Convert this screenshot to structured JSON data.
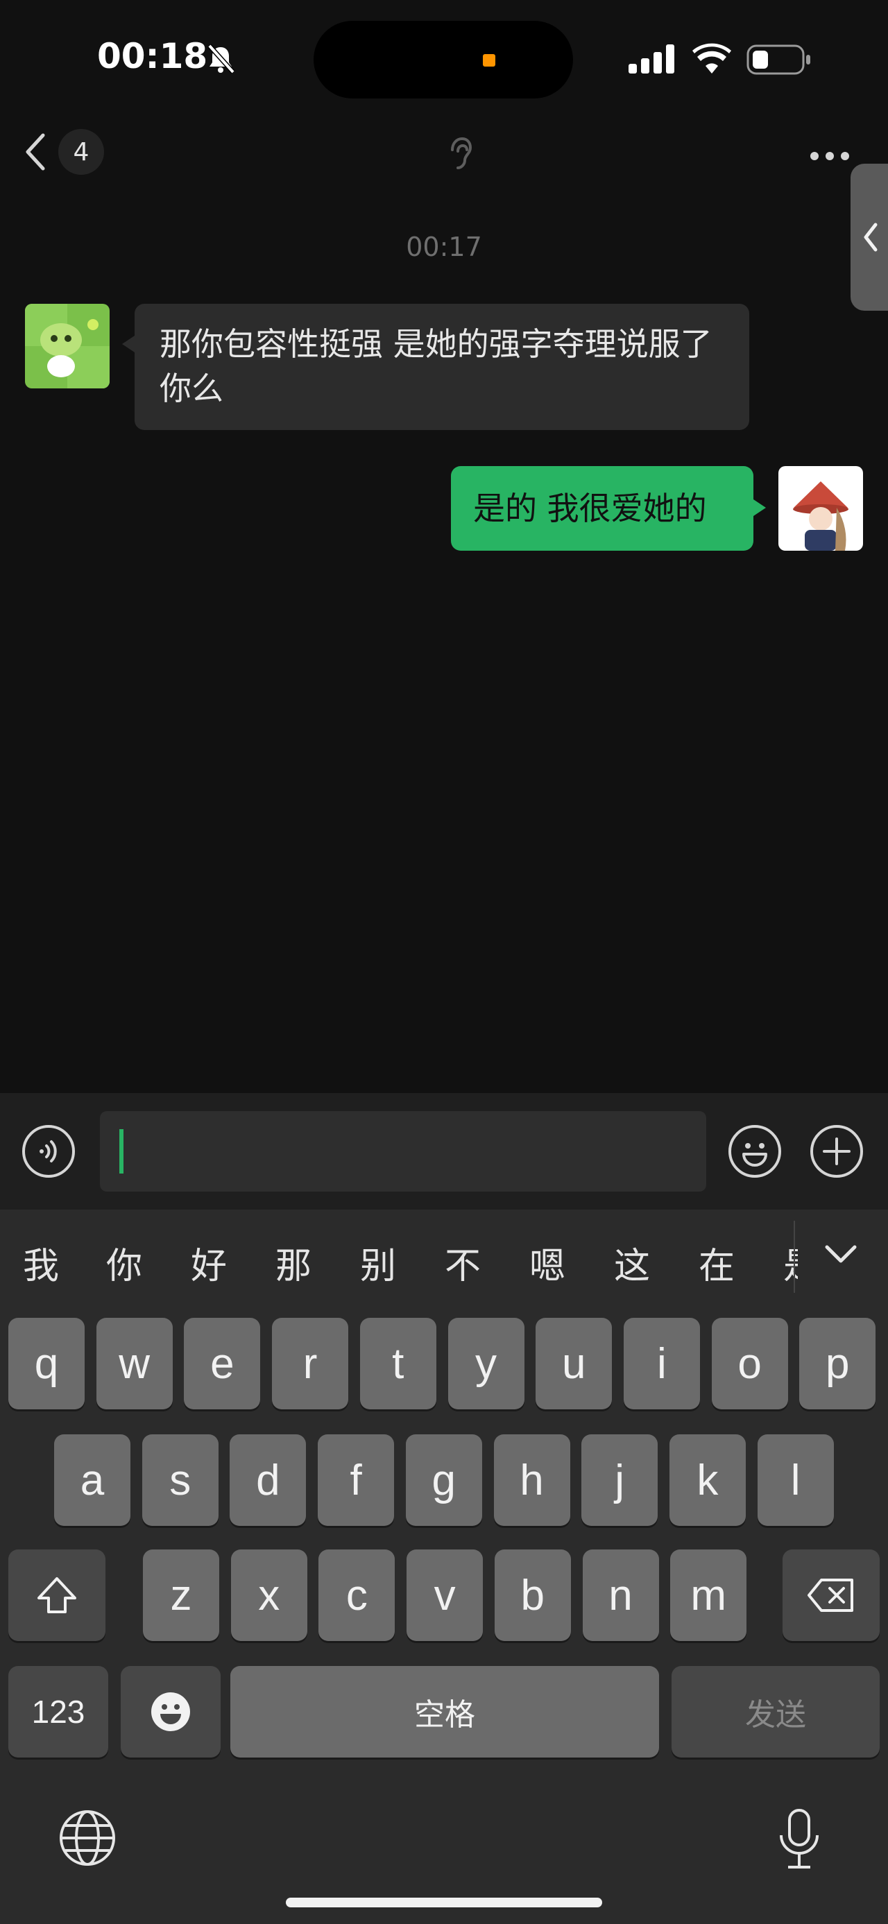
{
  "status_bar": {
    "time": "00:18"
  },
  "nav": {
    "back_count": "4"
  },
  "chat": {
    "timestamp": "00:17",
    "messages": [
      {
        "side": "left",
        "text": "那你包容性挺强 是她的强字夺理说服了你么"
      },
      {
        "side": "right",
        "text": "是的 我很爱她的"
      }
    ]
  },
  "input": {
    "value": "",
    "placeholder": ""
  },
  "keyboard": {
    "candidates": [
      "我",
      "你",
      "好",
      "那",
      "别",
      "不",
      "嗯",
      "这",
      "在",
      "是"
    ],
    "row1": [
      "q",
      "w",
      "e",
      "r",
      "t",
      "y",
      "u",
      "i",
      "o",
      "p"
    ],
    "row2": [
      "a",
      "s",
      "d",
      "f",
      "g",
      "h",
      "j",
      "k",
      "l"
    ],
    "row3": [
      "z",
      "x",
      "c",
      "v",
      "b",
      "n",
      "m"
    ],
    "numbers_label": "123",
    "space_label": "空格",
    "send_label": "发送"
  },
  "icons": [
    "bell-mute-icon",
    "signal-icon",
    "wifi-icon",
    "battery-icon",
    "back-chevron-icon",
    "ear-icon",
    "more-icon",
    "voice-icon",
    "emoji-icon",
    "plus-icon",
    "shift-icon",
    "delete-icon",
    "globe-icon",
    "mic-icon",
    "collapse-icon"
  ],
  "colors": {
    "accent": "#28b463",
    "background": "#111111",
    "bubble_left": "#2c2c2c"
  }
}
